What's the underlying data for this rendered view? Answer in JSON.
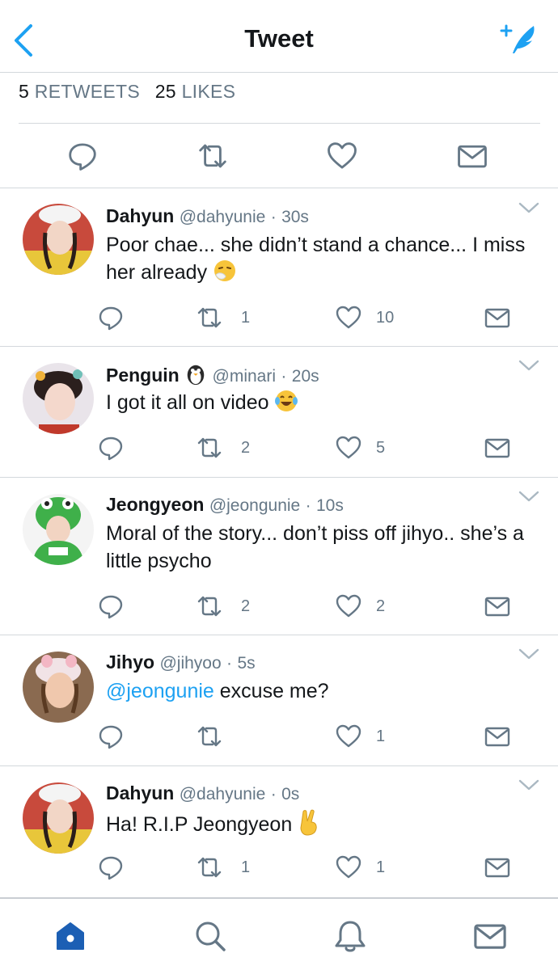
{
  "header": {
    "title": "Tweet"
  },
  "stats": {
    "retweets_count": "5",
    "retweets_label": "RETWEETS",
    "likes_count": "25",
    "likes_label": "LIKES"
  },
  "colors": {
    "accent": "#1da1f2",
    "icon_gray": "#657786",
    "divider": "#d3d8dc",
    "home_active": "#1c5fb4"
  },
  "replies": [
    {
      "name": "Dahyun",
      "handle": "@dahyunie",
      "dot": "·",
      "time": "30s",
      "text": "Poor chae... she didn’t stand a chance... I miss her already",
      "emoji": "sneezing-face-emoji",
      "retweets": "1",
      "likes": "10"
    },
    {
      "name": "Penguin",
      "handle": "@minari",
      "dot": "·",
      "time": "20s",
      "text": "I got it all on video",
      "emoji": "tears-of-joy-emoji",
      "badge": "penguin-emoji",
      "retweets": "2",
      "likes": "5"
    },
    {
      "name": "Jeongyeon",
      "handle": "@jeongunie",
      "dot": "·",
      "time": "10s",
      "text": "Moral of the story... don’t piss off jihyo.. she’s a little psycho",
      "retweets": "2",
      "likes": "2"
    },
    {
      "name": "Jihyo",
      "handle": "@jihyoo",
      "dot": "·",
      "time": "5s",
      "mention": "@jeongunie",
      "text": " excuse me?",
      "retweets": "",
      "likes": "1"
    },
    {
      "name": "Dahyun",
      "handle": "@dahyunie",
      "dot": "·",
      "time": "0s",
      "text": "Ha! R.I.P Jeongyeon",
      "emoji": "victory-hand-emoji",
      "retweets": "1",
      "likes": "1"
    }
  ],
  "icons": {
    "back": "chevron-left-icon",
    "compose": "compose-tweet-icon",
    "reply": "reply-icon",
    "retweet": "retweet-icon",
    "like": "heart-icon",
    "dm": "envelope-icon",
    "caret": "chevron-down-icon",
    "home": "home-icon",
    "search": "search-icon",
    "notifications": "bell-icon",
    "messages": "envelope-icon"
  }
}
